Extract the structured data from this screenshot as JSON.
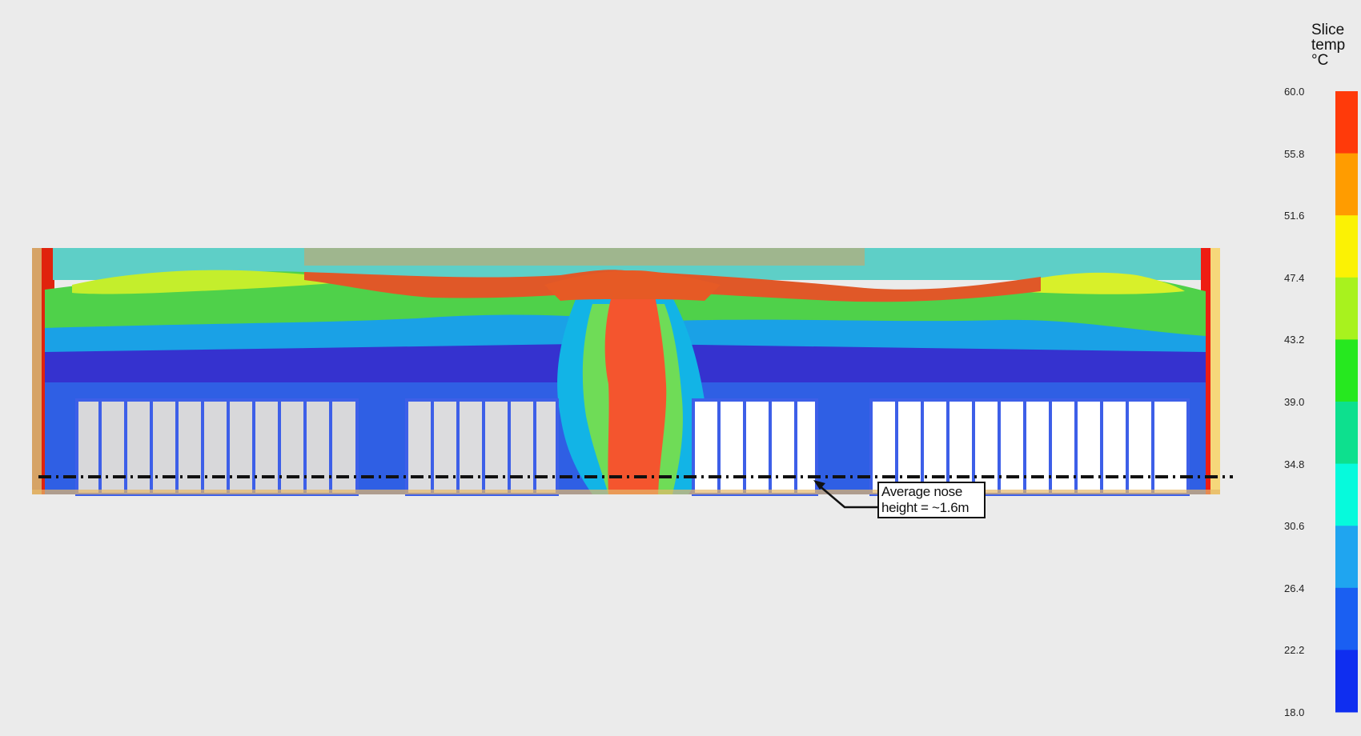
{
  "legend": {
    "title": "Slice\ntemp\n°C",
    "ticks": [
      "60.0",
      "55.8",
      "51.6",
      "47.4",
      "43.2",
      "39.0",
      "34.8",
      "30.6",
      "26.4",
      "22.2",
      "18.0"
    ],
    "band_colors": [
      "#ff3a0a",
      "#ff9c00",
      "#fbf204",
      "#a8f21e",
      "#26e81f",
      "#0de08e",
      "#06fadc",
      "#1fa5f0",
      "#1a5ff2",
      "#0f2ef0"
    ]
  },
  "annotation": {
    "text": "Average nose height = ~1.6m"
  },
  "colors": {
    "background": "#ebebeb",
    "cool_fill": "#3333cc",
    "hot_plume": "#f4552e",
    "container_fill": "#d7d7da",
    "reference_line": "#111111"
  }
}
